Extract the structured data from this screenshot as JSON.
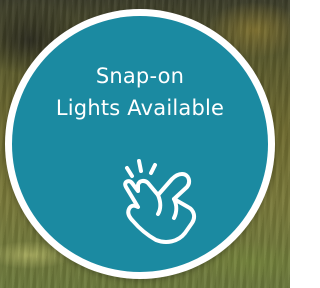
{
  "badge": {
    "line1": "Snap-on",
    "line2": "Lights Available",
    "icon": "finger-snap-icon",
    "colors": {
      "circle": "#1b8aa1",
      "ring": "#ffffff",
      "text": "#ffffff"
    }
  }
}
